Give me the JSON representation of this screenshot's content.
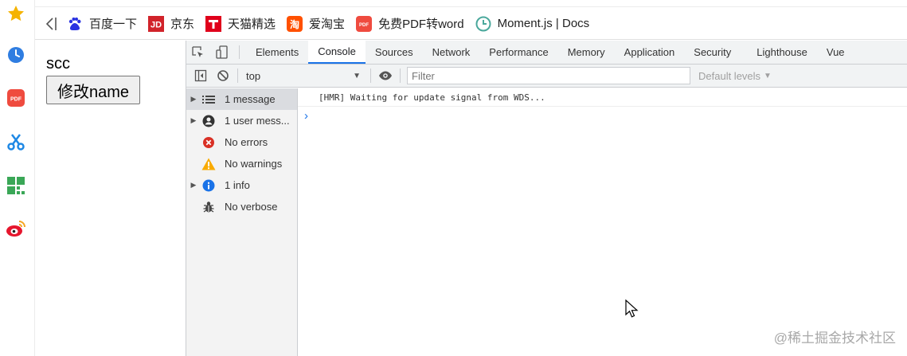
{
  "bookmarks": [
    {
      "label": "百度一下",
      "icon": "baidu-paw-icon"
    },
    {
      "label": "京东",
      "icon": "jd-logo-icon"
    },
    {
      "label": "天猫精选",
      "icon": "tmall-logo-icon"
    },
    {
      "label": "爱淘宝",
      "icon": "taobao-logo-icon"
    },
    {
      "label": "免费PDF转word",
      "icon": "pdf-logo-icon"
    },
    {
      "label": "Moment.js | Docs",
      "icon": "clock-icon"
    }
  ],
  "page": {
    "name_text": "scc",
    "button_label": "修改name"
  },
  "devtools": {
    "tabs": [
      "Elements",
      "Console",
      "Sources",
      "Network",
      "Performance",
      "Memory",
      "Application",
      "Security",
      "Lighthouse",
      "Vue"
    ],
    "active_tab": "Console",
    "context": "top",
    "filter_placeholder": "Filter",
    "levels_label": "Default levels",
    "sidebar": [
      {
        "label": "1 message",
        "icon": "list-icon",
        "expandable": true
      },
      {
        "label": "1 user mess...",
        "icon": "user-icon",
        "expandable": true
      },
      {
        "label": "No errors",
        "icon": "error-icon",
        "expandable": false
      },
      {
        "label": "No warnings",
        "icon": "warning-icon",
        "expandable": false
      },
      {
        "label": "1 info",
        "icon": "info-icon",
        "expandable": true
      },
      {
        "label": "No verbose",
        "icon": "bug-icon",
        "expandable": false
      }
    ],
    "log": "[HMR] Waiting for update signal from WDS...",
    "prompt_symbol": "›"
  },
  "watermark": "@稀土掘金技术社区",
  "colors": {
    "accent": "#1a73e8",
    "error": "#d93025",
    "warning": "#f9ab00",
    "info": "#1a73e8"
  }
}
